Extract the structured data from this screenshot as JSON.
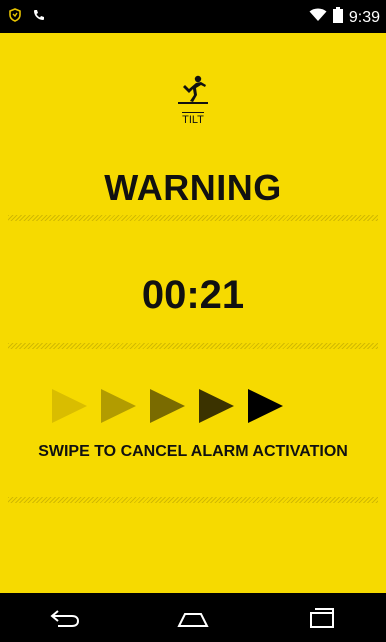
{
  "status": {
    "time": "9:39",
    "icons": [
      "shield-icon",
      "phone-icon",
      "wifi-icon",
      "battery-icon"
    ]
  },
  "alarm": {
    "icon": "tilt-icon",
    "tilt_label": "TILT",
    "warning": "WARNING",
    "countdown": "00:21",
    "swipe_text": "SWIPE TO CANCEL ALARM ACTIVATION"
  },
  "arrows": {
    "colors": [
      "#d9bd00",
      "#b29c00",
      "#7a6b00",
      "#3b3300",
      "#000000"
    ]
  },
  "navbar": {
    "icons": [
      "back-icon",
      "home-icon",
      "recent-apps-icon"
    ]
  },
  "colors": {
    "background": "#f6da00",
    "text": "#111111",
    "status_bar": "#000000"
  }
}
